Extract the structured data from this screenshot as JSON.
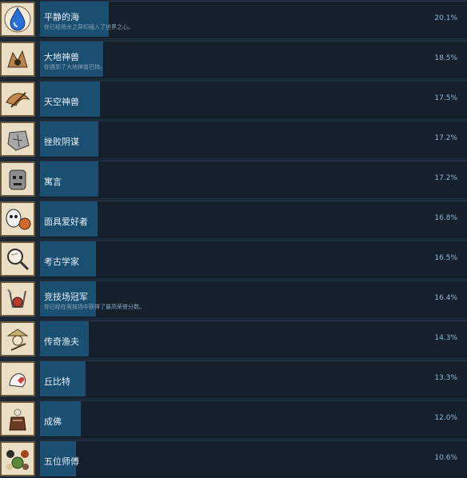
{
  "achievements": [
    {
      "title": "平静的海",
      "desc": "你已经将水之异印插入了世界之心。",
      "percent_label": "20.1%",
      "percent": 20.1,
      "icon": "water-drop-icon"
    },
    {
      "title": "大地神兽",
      "desc": "你遇到了大地神兽巴特。",
      "percent_label": "18.5%",
      "percent": 18.5,
      "icon": "earth-beast-icon"
    },
    {
      "title": "天空神兽",
      "desc": "",
      "percent_label": "17.5%",
      "percent": 17.5,
      "icon": "sky-beast-icon"
    },
    {
      "title": "挫败阴谋",
      "desc": "",
      "percent_label": "17.2%",
      "percent": 17.2,
      "icon": "shattered-stone-icon"
    },
    {
      "title": "寓言",
      "desc": "",
      "percent_label": "17.2%",
      "percent": 17.2,
      "icon": "stone-golem-icon"
    },
    {
      "title": "面具爱好者",
      "desc": "",
      "percent_label": "16.8%",
      "percent": 16.8,
      "icon": "mask-icon"
    },
    {
      "title": "考古学家",
      "desc": "",
      "percent_label": "16.5%",
      "percent": 16.5,
      "icon": "magnifier-icon"
    },
    {
      "title": "竞技场冠军",
      "desc": "你已经在竞技场中获得了最高荣誉分数。",
      "percent_label": "16.4%",
      "percent": 16.4,
      "icon": "arena-champion-icon"
    },
    {
      "title": "传奇渔夫",
      "desc": "",
      "percent_label": "14.3%",
      "percent": 14.3,
      "icon": "fisherman-icon"
    },
    {
      "title": "丘比特",
      "desc": "",
      "percent_label": "13.3%",
      "percent": 13.3,
      "icon": "cupid-icon"
    },
    {
      "title": "成佛",
      "desc": "",
      "percent_label": "12.0%",
      "percent": 12.0,
      "icon": "monk-icon"
    },
    {
      "title": "五位师傅",
      "desc": "",
      "percent_label": "10.6%",
      "percent": 10.6,
      "icon": "five-masters-icon"
    }
  ],
  "colors": {
    "background": "#1b2838",
    "bar_fill": "#1a4f72",
    "percent_text": "#8fb9d8",
    "icon_frame": "#eadfc4"
  }
}
